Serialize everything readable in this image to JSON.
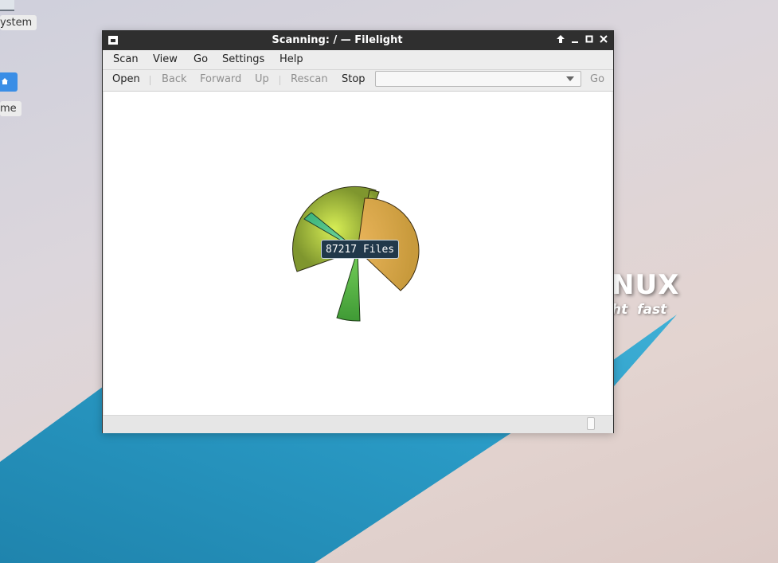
{
  "desktop": {
    "icons": [
      {
        "label": "ystem"
      },
      {
        "label": "me"
      }
    ],
    "logo_text": "NUX",
    "logo_subtext": "ht fast"
  },
  "window": {
    "title": "Scanning: / — Filelight",
    "menus": [
      "Scan",
      "View",
      "Go",
      "Settings",
      "Help"
    ],
    "toolbar": {
      "open": "Open",
      "back": "Back",
      "forward": "Forward",
      "up": "Up",
      "rescan": "Rescan",
      "stop": "Stop",
      "go": "Go",
      "path_value": ""
    },
    "tooltip": "87217 Files"
  },
  "colors": {
    "titlebar": "#2f2f2f",
    "tooltip_bg": "#21384a",
    "accent_stripe": "#2b9cc4"
  }
}
